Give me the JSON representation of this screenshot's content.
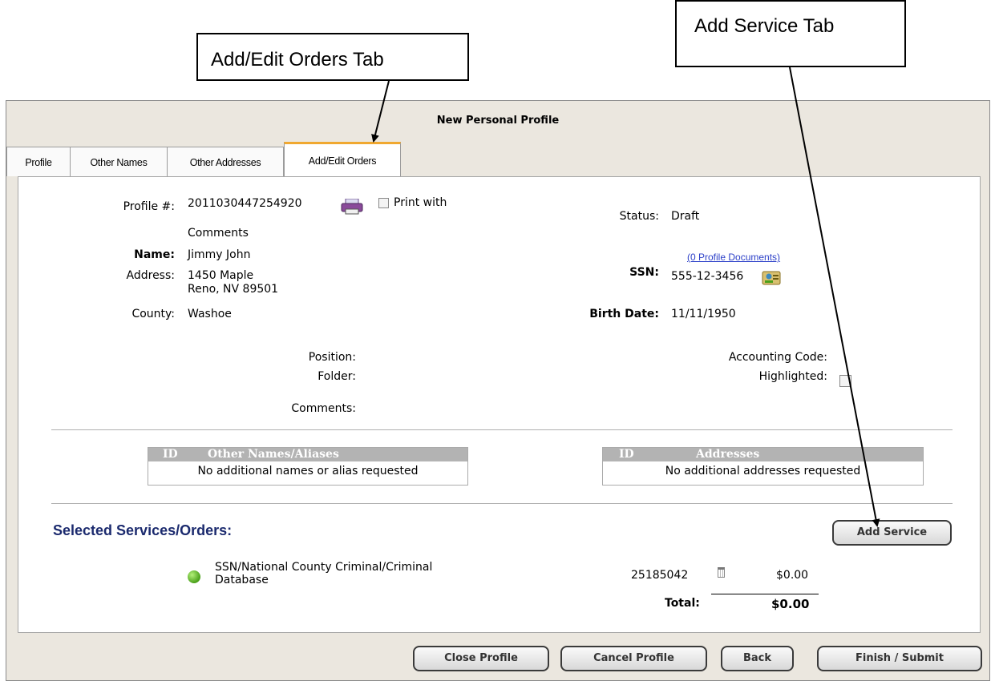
{
  "callouts": {
    "orders_tab": "Add/Edit Orders Tab",
    "service_tab": "Add Service Tab"
  },
  "window": {
    "title": "New Personal Profile"
  },
  "tabs": [
    {
      "label": "Profile"
    },
    {
      "label": "Other Names"
    },
    {
      "label": "Other Addresses"
    },
    {
      "label": "Add/Edit Orders",
      "active": true
    }
  ],
  "profile": {
    "profile_num_label": "Profile #:",
    "profile_num": "2011030447254920",
    "print_with_label": "Print with",
    "comments_cont": "Comments",
    "name_label": "Name:",
    "name": "Jimmy John",
    "address_label": "Address:",
    "address_line1": "1450 Maple",
    "address_line2": "Reno, NV 89501",
    "county_label": "County:",
    "county": "Washoe",
    "status_label": "Status:",
    "status": "Draft",
    "documents_link": "(0 Profile Documents)",
    "ssn_label": "SSN:",
    "ssn": "555-12-3456",
    "birth_label": "Birth Date:",
    "birth_date": "11/11/1950",
    "position_label": "Position:",
    "folder_label": "Folder:",
    "comments_label": "Comments:",
    "accounting_label": "Accounting Code:",
    "highlighted_label": "Highlighted:"
  },
  "names_table": {
    "id_header": "ID",
    "title_header": "Other Names/Aliases",
    "empty_text": "No additional names or alias requested"
  },
  "addresses_table": {
    "id_header": "ID",
    "title_header": "Addresses",
    "empty_text": "No additional addresses requested"
  },
  "services": {
    "section_title": "Selected Services/Orders:",
    "add_button": "Add Service",
    "items": [
      {
        "name_line1": "SSN/National County Criminal/Criminal",
        "name_line2": "Database",
        "order_id": "25185042",
        "price": "$0.00"
      }
    ],
    "total_label": "Total:",
    "total_value": "$0.00"
  },
  "footer_buttons": {
    "close": "Close Profile",
    "cancel": "Cancel Profile",
    "back": "Back",
    "finish": "Finish / Submit"
  },
  "colors": {
    "tab_accent": "#f0a830",
    "section_title": "#1b2a6e",
    "link": "#2b3fc8",
    "status_dot": "#4aa01a"
  }
}
